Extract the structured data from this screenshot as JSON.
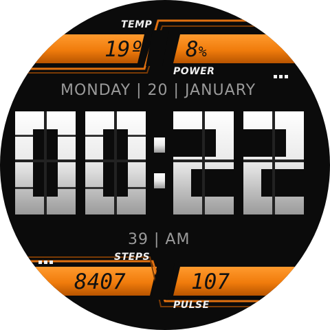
{
  "watch_face": {
    "accent_color": "#f07c0c",
    "temp": {
      "label": "TEMP",
      "value": "19º"
    },
    "power": {
      "label": "POWER",
      "value": "8",
      "unit": "%"
    },
    "date": {
      "day": "MONDAY",
      "date": "20",
      "month": "JANUARY",
      "separator": "|"
    },
    "time": {
      "hours": "00",
      "minutes": "22",
      "seconds": "39",
      "ampm": "AM",
      "separator": "|"
    },
    "steps": {
      "label": "STEPS",
      "value": "8407"
    },
    "pulse": {
      "label": "PULSE",
      "value": "107"
    },
    "icons": [
      "dots-indicator-icon",
      "dots-indicator-icon",
      "colon-separator"
    ]
  }
}
